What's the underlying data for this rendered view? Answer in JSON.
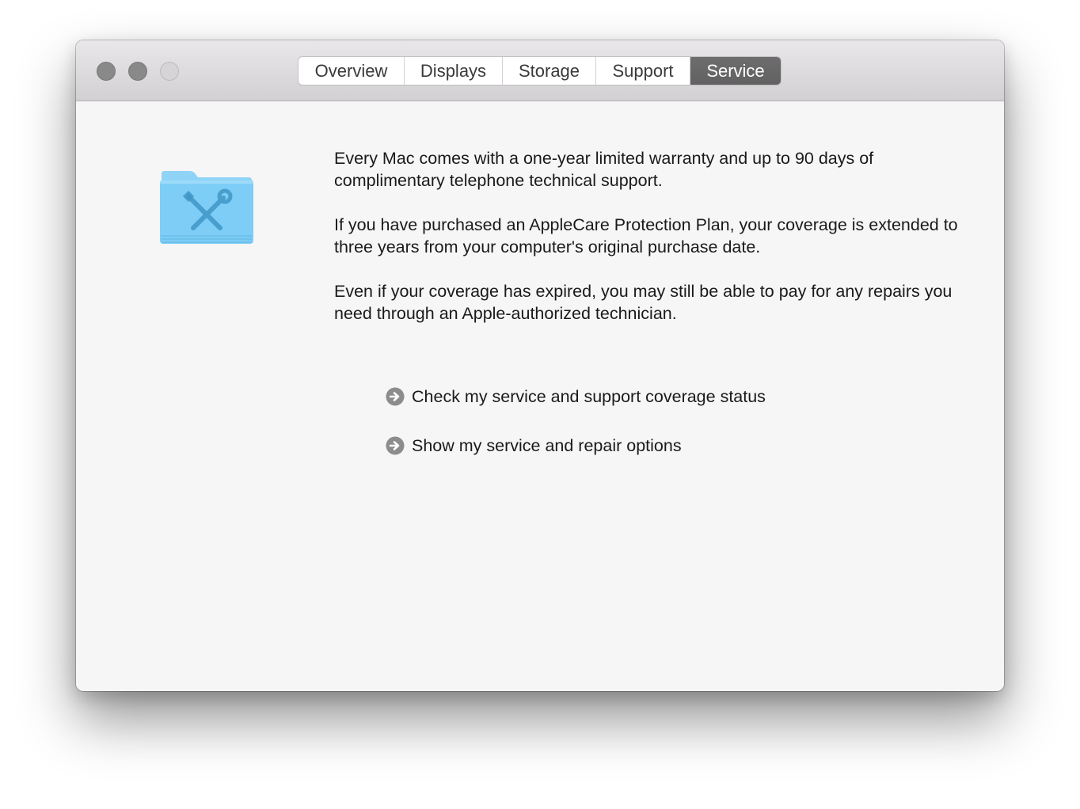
{
  "window": {
    "tabs": [
      {
        "label": "Overview",
        "active": false
      },
      {
        "label": "Displays",
        "active": false
      },
      {
        "label": "Storage",
        "active": false
      },
      {
        "label": "Support",
        "active": false
      },
      {
        "label": "Service",
        "active": true
      }
    ]
  },
  "service": {
    "icon": "folder-tools-icon",
    "paragraphs": [
      "Every Mac comes with a one-year limited warranty and up to 90 days of complimentary telephone technical support.",
      "If you have purchased an AppleCare Protection Plan, your coverage is extended to three years from your computer's original purchase date.",
      "Even if your coverage has expired, you may still be able to pay for any repairs you need through an Apple-authorized technician."
    ],
    "links": [
      {
        "label": "Check my service and support coverage status",
        "icon": "arrow-circle-icon"
      },
      {
        "label": "Show my service and repair options",
        "icon": "arrow-circle-icon"
      }
    ]
  },
  "colors": {
    "active_tab": "#666566",
    "folder": "#7ecdf6",
    "link_arrow": "#8c8c8c"
  }
}
